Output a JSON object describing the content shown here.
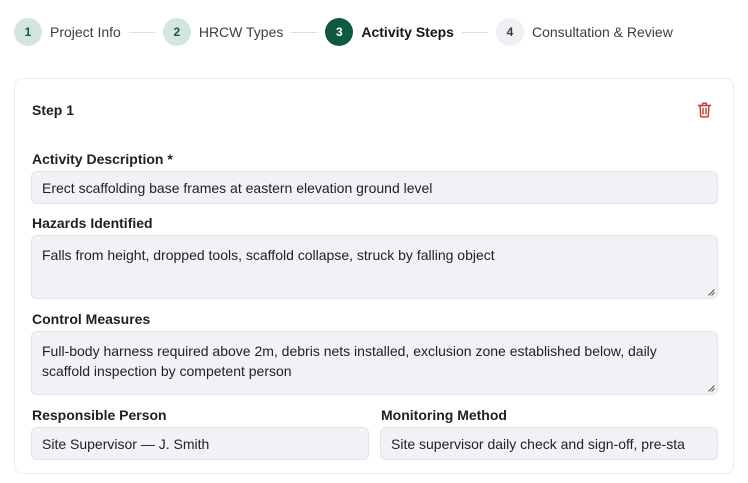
{
  "stepper": {
    "steps": [
      {
        "number": "1",
        "label": "Project Info",
        "state": "done"
      },
      {
        "number": "2",
        "label": "HRCW Types",
        "state": "done"
      },
      {
        "number": "3",
        "label": "Activity Steps",
        "state": "active"
      },
      {
        "number": "4",
        "label": "Consultation & Review",
        "state": "todo"
      }
    ]
  },
  "step_card": {
    "title": "Step 1",
    "delete_icon": "trash-icon",
    "activity_description": {
      "label": "Activity Description *",
      "value": "Erect scaffolding base frames at eastern elevation ground level"
    },
    "hazards_identified": {
      "label": "Hazards Identified",
      "value": "Falls from height, dropped tools, scaffold collapse, struck by falling object"
    },
    "control_measures": {
      "label": "Control Measures",
      "value": "Full-body harness required above 2m, debris nets installed, exclusion zone established below, daily scaffold inspection by competent person"
    },
    "responsible_person": {
      "label": "Responsible Person",
      "value": "Site Supervisor — J. Smith"
    },
    "monitoring_method": {
      "label": "Monitoring Method",
      "value": "Site supervisor daily check and sign-off, pre-sta"
    }
  },
  "colors": {
    "accent": "#0e5a41",
    "accent_light": "#d2e6de",
    "input_bg": "#f2f1f5",
    "delete": "#c0392b"
  }
}
